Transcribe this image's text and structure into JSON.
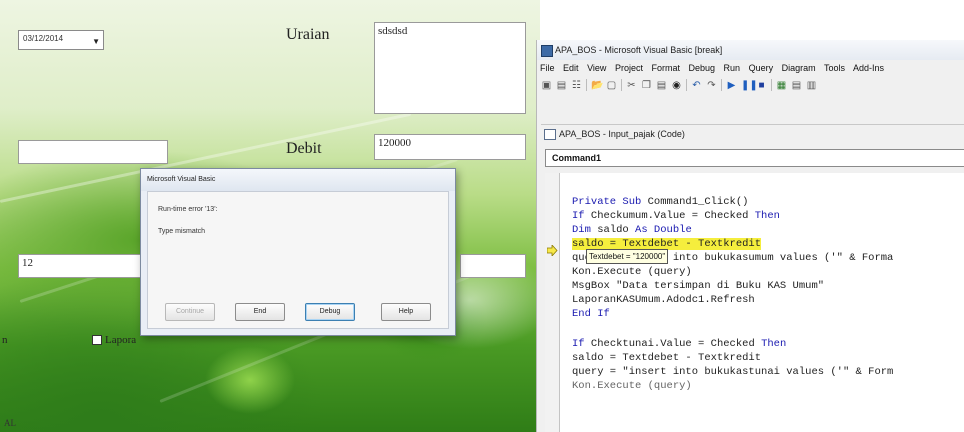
{
  "form": {
    "date_value": "03/12/2014",
    "uraian_label": "Uraian",
    "uraian_value": "sdsdsd",
    "debit_label": "Debit",
    "debit_value": "120000",
    "left_field_2_value": "12",
    "checkbox_label": "Lapora",
    "edge_label": "n",
    "bottom_corner_text": "AL"
  },
  "msgbox": {
    "title": "Microsoft Visual Basic",
    "error_line": "Run-time error '13':",
    "error_desc": "Type mismatch",
    "buttons": [
      "Continue",
      "End",
      "Debug",
      "Help"
    ]
  },
  "ide": {
    "title": "APA_BOS - Microsoft Visual Basic [break]",
    "menu": [
      "File",
      "Edit",
      "View",
      "Project",
      "Format",
      "Debug",
      "Run",
      "Query",
      "Diagram",
      "Tools",
      "Add-Ins"
    ],
    "code_window_title": "APA_BOS - Input_pajak (Code)",
    "object_combo": "Command1",
    "tooltip": "Textdebet = \"120000\"",
    "code_lines": [
      "Private Sub Command1_Click()",
      "If Checkumum.Value = Checked Then",
      "Dim saldo As Double",
      "saldo = Textdebet - Textkredit",
      "query = \"insert into bukukasumum values ('\" & Forma",
      "Kon.Execute (query)",
      "MsgBox \"Data tersimpan di Buku KAS Umum\"",
      "LaporanKASUmum.Adodc1.Refresh",
      "End If",
      "",
      "If Checktunai.Value = Checked Then",
      "saldo = Textdebet - Textkredit",
      "query = \"insert into bukukastunai values ('\" & Form",
      "Kon.Execute (query)"
    ]
  },
  "colors": {
    "keyword": "#1a1ab0",
    "highlight": "#f5ee3d",
    "tooltip_bg": "#ffffe1"
  }
}
